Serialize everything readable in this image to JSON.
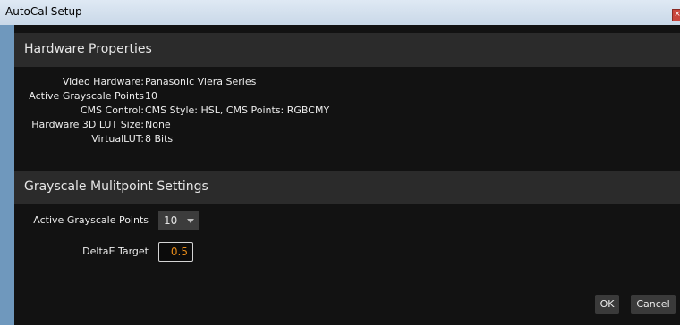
{
  "window": {
    "title": "AutoCal Setup"
  },
  "hardware": {
    "header": "Hardware Properties",
    "rows": [
      {
        "label": "Video Hardware:",
        "value": "Panasonic Viera Series"
      },
      {
        "label": "Active Grayscale Points",
        "value": "10"
      },
      {
        "label": "CMS Control:",
        "value": "CMS Style: HSL, CMS Points: RGBCMY"
      },
      {
        "label": "Hardware 3D LUT Size:",
        "value": "None"
      },
      {
        "label": "VirtualLUT:",
        "value": "8 Bits"
      }
    ]
  },
  "grayscale": {
    "header": "Grayscale Mulitpoint Settings",
    "points_label": "Active Grayscale Points",
    "points_value": "10",
    "delta_label": "DeltaE Target",
    "delta_value": "0.5"
  },
  "buttons": {
    "ok": "OK",
    "cancel": "Cancel"
  },
  "colors": {
    "accent": "#e88c1a",
    "background": "#121212",
    "header": "#2b2b2b"
  }
}
